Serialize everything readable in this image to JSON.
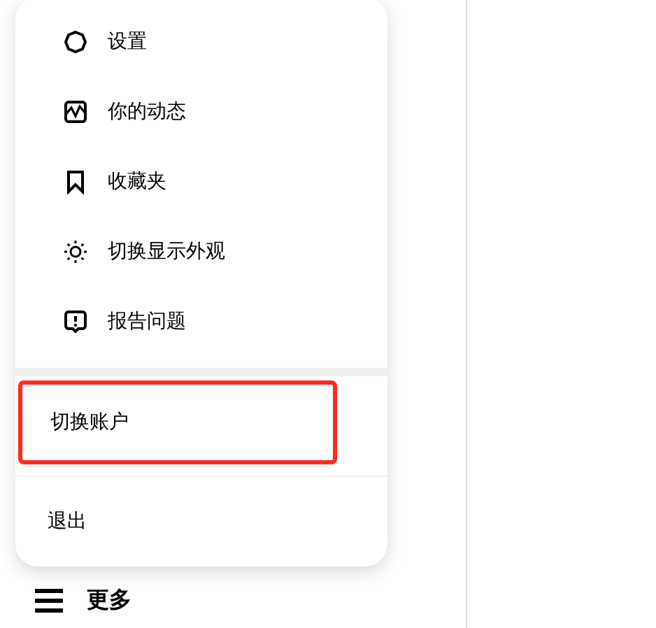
{
  "menu": {
    "items": [
      {
        "label": "设置",
        "kind": "settings"
      },
      {
        "label": "你的动态",
        "kind": "activity"
      },
      {
        "label": "收藏夹",
        "kind": "saved"
      },
      {
        "label": "切换显示外观",
        "kind": "appearance"
      },
      {
        "label": "报告问题",
        "kind": "report"
      }
    ],
    "account_items": [
      {
        "label": "切换账户",
        "highlighted": true
      }
    ],
    "logout": {
      "label": "退出"
    }
  },
  "more": {
    "label": "更多"
  }
}
